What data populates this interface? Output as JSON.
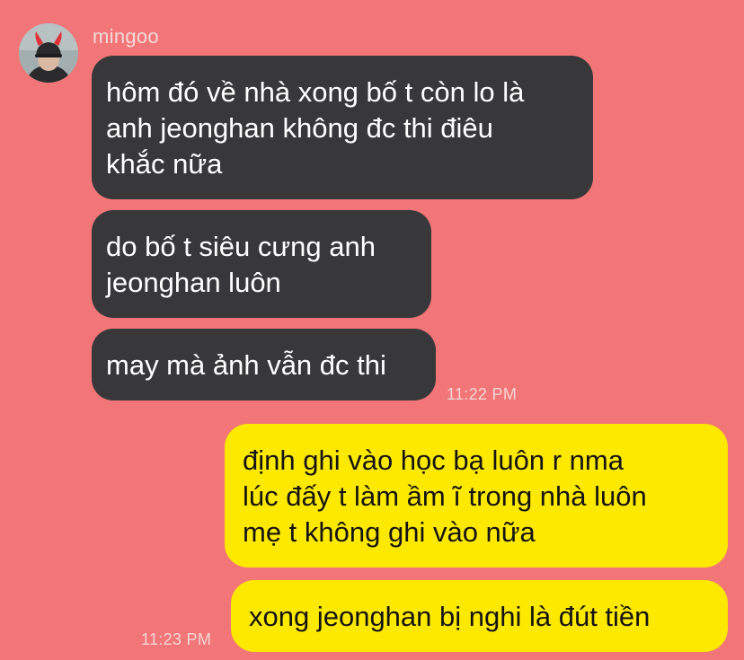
{
  "chat": {
    "sender_name": "mingoo",
    "incoming": [
      {
        "lines": [
          "hôm đó về nhà xong bố t còn lo là",
          "anh jeonghan không đc thi điêu",
          "khắc nữa"
        ]
      },
      {
        "lines": [
          "do bố t siêu cưng anh",
          "jeonghan luôn"
        ]
      },
      {
        "lines": [
          "may mà ảnh vẫn đc thi"
        ]
      }
    ],
    "incoming_time": "11:22 PM",
    "outgoing": [
      {
        "lines": [
          "định ghi vào học bạ luôn r nma",
          "lúc đấy t làm ầm ĩ trong nhà luôn",
          "mẹ t không ghi vào nữa"
        ]
      },
      {
        "lines": [
          "xong jeonghan bị nghi là đút tiền"
        ]
      }
    ],
    "outgoing_time": "11:23 PM"
  },
  "colors": {
    "background": "#f27677",
    "incoming_bubble": "#38383a",
    "outgoing_bubble": "#fde900"
  },
  "icons": {
    "avatar": "user-avatar-with-devil-horns"
  }
}
